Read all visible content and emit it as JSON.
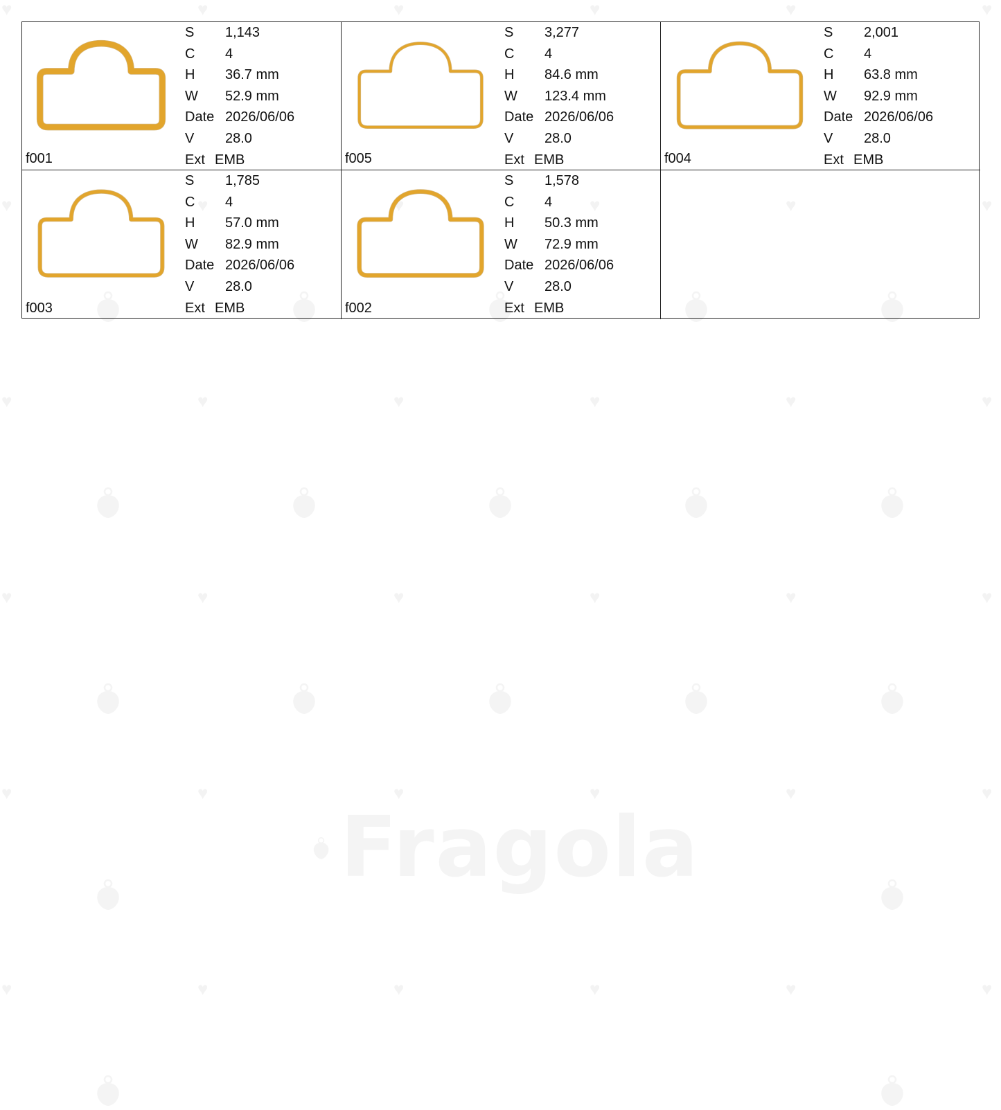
{
  "colors": {
    "outline": "#e2a52c",
    "outline_dark": "#b07a10",
    "grid_line": "#222222",
    "watermark": "#f3f3f3"
  },
  "watermark": {
    "logo_text": "Fragola",
    "icon": "strawberry-icon",
    "pattern_icon": "heart-icon"
  },
  "labels": {
    "stitches": "S",
    "colors": "C",
    "height": "H",
    "width": "W",
    "date": "Date",
    "version": "V",
    "extension": "Ext"
  },
  "designs": [
    {
      "name": "f001",
      "stitches": "1,143",
      "colors": "4",
      "height": "36.7 mm",
      "width": "52.9 mm",
      "date": "2026/06/06",
      "version": "28.0",
      "ext": "EMB"
    },
    {
      "name": "f005",
      "stitches": "3,277",
      "colors": "4",
      "height": "84.6 mm",
      "width": "123.4 mm",
      "date": "2026/06/06",
      "version": "28.0",
      "ext": "EMB"
    },
    {
      "name": "f004",
      "stitches": "2,001",
      "colors": "4",
      "height": "63.8 mm",
      "width": "92.9 mm",
      "date": "2026/06/06",
      "version": "28.0",
      "ext": "EMB"
    },
    {
      "name": "f003",
      "stitches": "1,785",
      "colors": "4",
      "height": "57.0 mm",
      "width": "82.9 mm",
      "date": "2026/06/06",
      "version": "28.0",
      "ext": "EMB"
    },
    {
      "name": "f002",
      "stitches": "1,578",
      "colors": "4",
      "height": "50.3 mm",
      "width": "72.9 mm",
      "date": "2026/06/06",
      "version": "28.0",
      "ext": "EMB"
    }
  ]
}
